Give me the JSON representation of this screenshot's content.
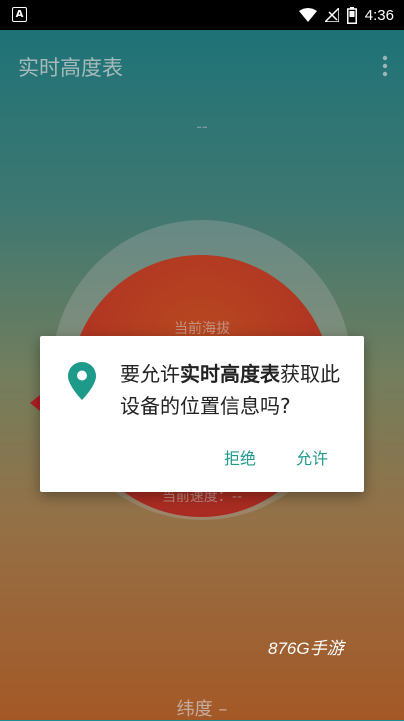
{
  "status_bar": {
    "left_icon_label": "A",
    "time": "4:36",
    "icons": [
      "wifi-icon",
      "cellular-icon",
      "battery-icon"
    ]
  },
  "app_bar": {
    "title": "实时高度表",
    "menu_icon": "more-vert-icon"
  },
  "main": {
    "top_value": "--",
    "current_altitude_label": "当前海拔",
    "current_speed_label": "当前速度：--",
    "latitude_label": "纬度 –"
  },
  "dialog": {
    "icon": "location-pin-icon",
    "message_prefix": "要允许",
    "app_name": "实时高度表",
    "message_suffix": "获取此设备的位置信息吗?",
    "deny_label": "拒绝",
    "allow_label": "允许",
    "accent_color": "#1e9a8a"
  },
  "watermark": "876G手游"
}
